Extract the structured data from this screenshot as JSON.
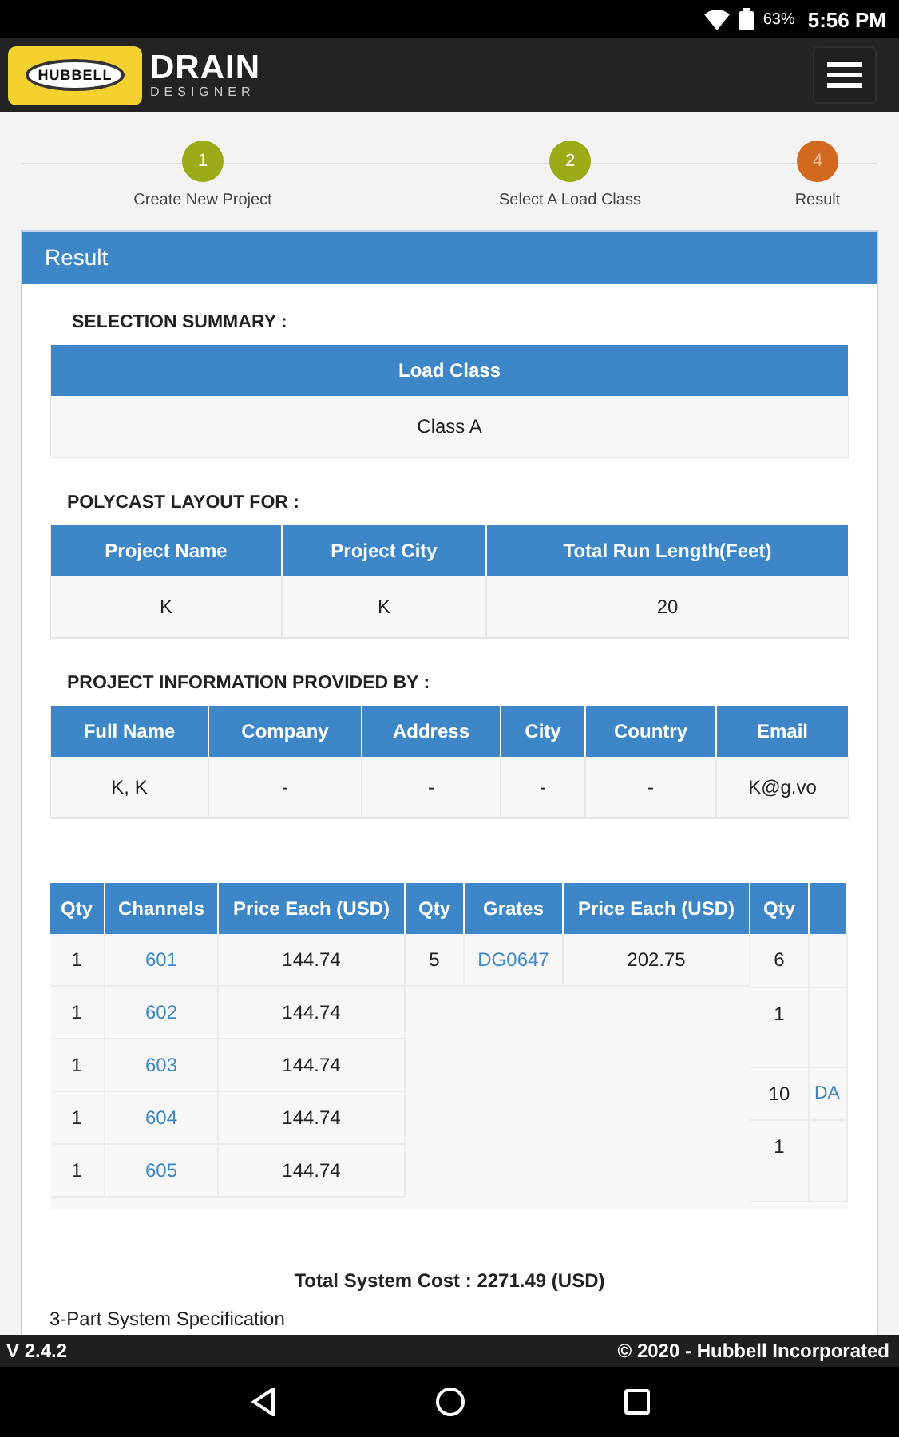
{
  "status_bar": {
    "battery": "63%",
    "time": "5:56 PM"
  },
  "header": {
    "logo_text": "HUBBELL",
    "title": "DRAIN",
    "subtitle": "DESIGNER"
  },
  "steps": [
    {
      "number": "1",
      "label": "Create New Project",
      "selected": false
    },
    {
      "number": "2",
      "label": "Select A Load Class",
      "selected": false
    },
    {
      "number": "4",
      "label": "Result",
      "selected": true
    }
  ],
  "panel_title": "Result",
  "tables": [
    {
      "heading": "SELECTION SUMMARY :",
      "columns": [
        "Load Class"
      ],
      "rows": [
        [
          "Class A"
        ]
      ]
    },
    {
      "heading": "POLYCAST LAYOUT FOR :",
      "columns": [
        "Project Name",
        "Project City",
        "Total Run Length(Feet)"
      ],
      "rows": [
        [
          "K",
          "K",
          "20"
        ]
      ]
    },
    {
      "heading": "PROJECT INFORMATION PROVIDED BY :",
      "columns": [
        "Full Name",
        "Company",
        "Address",
        "City",
        "Country",
        "Email"
      ],
      "rows": [
        [
          "K, K",
          "-",
          "-",
          "-",
          "-",
          "K@g.vo"
        ]
      ]
    }
  ],
  "bill_of_materials": [
    {
      "columns": [
        "Qty",
        "Channels",
        "Price Each (USD)"
      ],
      "rows": [
        [
          "1",
          "601",
          "144.74"
        ],
        [
          "1",
          "602",
          "144.74"
        ],
        [
          "1",
          "603",
          "144.74"
        ],
        [
          "1",
          "604",
          "144.74"
        ],
        [
          "1",
          "605",
          "144.74"
        ]
      ]
    },
    {
      "columns": [
        "Qty",
        "Grates",
        "Price Each (USD)"
      ],
      "rows": [
        [
          "5",
          "DG0647",
          "202.75"
        ]
      ]
    },
    {
      "columns": [
        "Qty"
      ],
      "rows": [
        [
          "6"
        ],
        [
          "1"
        ],
        [
          "10",
          "DA"
        ],
        [
          "1"
        ]
      ]
    }
  ],
  "total": "Total System Cost : 2271.49 (USD)",
  "spec_heading": "3-Part System Specification",
  "footer": {
    "version": "V 2.4.2",
    "copyright": "© 2020 - Hubbell Incorporated"
  }
}
